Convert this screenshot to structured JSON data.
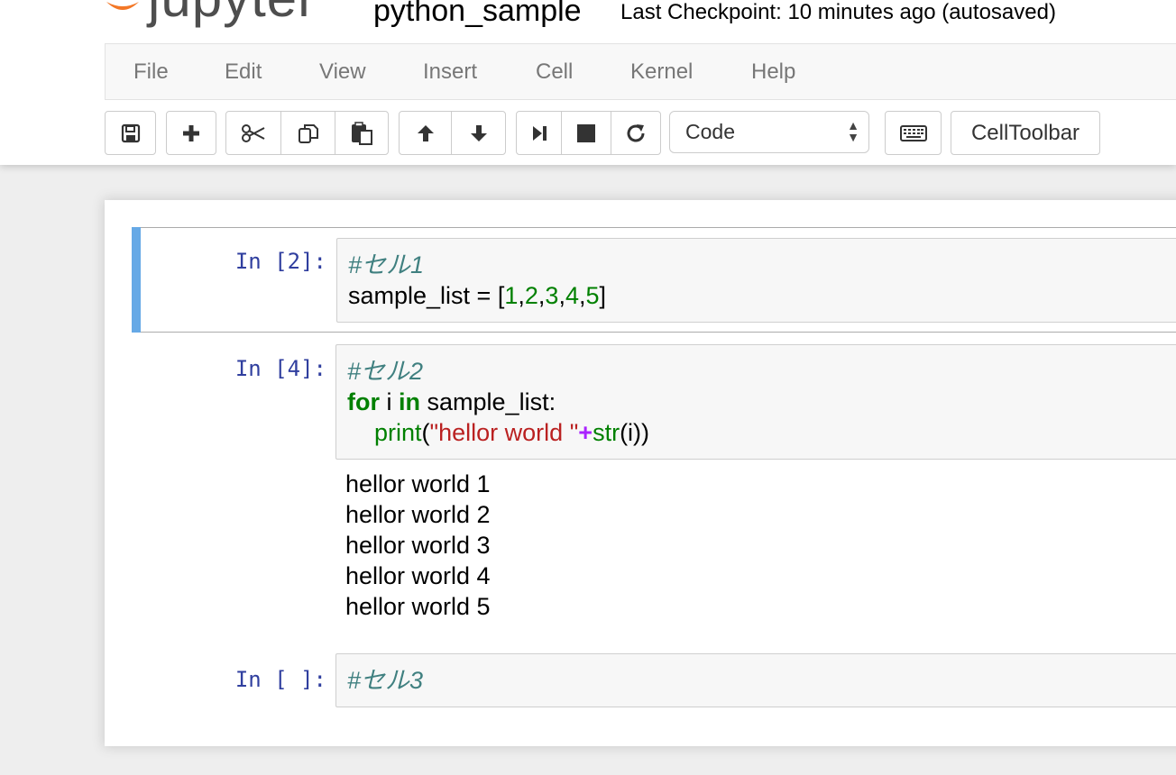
{
  "header": {
    "logo_text": "jupyter",
    "notebook_name": "python_sample",
    "checkpoint": "Last Checkpoint: 10 minutes ago (autosaved)"
  },
  "menubar": {
    "items": [
      {
        "label": "File"
      },
      {
        "label": "Edit"
      },
      {
        "label": "View"
      },
      {
        "label": "Insert"
      },
      {
        "label": "Cell"
      },
      {
        "label": "Kernel"
      },
      {
        "label": "Help"
      }
    ]
  },
  "toolbar": {
    "cell_type": "Code",
    "celltoolbar_label": "CellToolbar",
    "icons": [
      "save-icon",
      "plus-icon",
      "scissors-icon",
      "copy-icon",
      "paste-icon",
      "arrow-up-icon",
      "arrow-down-icon",
      "run-next-icon",
      "stop-icon",
      "restart-icon",
      "keyboard-icon"
    ]
  },
  "cells": [
    {
      "prompt": "In [2]:",
      "selected": true,
      "lines": [
        [
          {
            "t": "#セル1",
            "c": "cm-comment"
          }
        ],
        [
          {
            "t": "sample_list = [",
            "c": ""
          },
          {
            "t": "1",
            "c": "cm-number"
          },
          {
            "t": ",",
            "c": ""
          },
          {
            "t": "2",
            "c": "cm-number"
          },
          {
            "t": ",",
            "c": ""
          },
          {
            "t": "3",
            "c": "cm-number"
          },
          {
            "t": ",",
            "c": ""
          },
          {
            "t": "4",
            "c": "cm-number"
          },
          {
            "t": ",",
            "c": ""
          },
          {
            "t": "5",
            "c": "cm-number"
          },
          {
            "t": "]",
            "c": ""
          }
        ]
      ],
      "outputs": []
    },
    {
      "prompt": "In [4]:",
      "selected": false,
      "lines": [
        [
          {
            "t": "#セル2",
            "c": "cm-comment"
          }
        ],
        [
          {
            "t": "for",
            "c": "cm-keyword"
          },
          {
            "t": " i ",
            "c": ""
          },
          {
            "t": "in",
            "c": "cm-keyword"
          },
          {
            "t": " sample_list:",
            "c": ""
          }
        ],
        [
          {
            "t": "    ",
            "c": ""
          },
          {
            "t": "print",
            "c": "cm-builtin"
          },
          {
            "t": "(",
            "c": ""
          },
          {
            "t": "\"hellor world \"",
            "c": "cm-string"
          },
          {
            "t": "+",
            "c": "cm-op"
          },
          {
            "t": "str",
            "c": "cm-builtin"
          },
          {
            "t": "(i))",
            "c": ""
          }
        ]
      ],
      "outputs": [
        "hellor world 1",
        "hellor world 2",
        "hellor world 3",
        "hellor world 4",
        "hellor world 5"
      ]
    },
    {
      "prompt": "In [ ]:",
      "selected": false,
      "lines": [
        [
          {
            "t": "#セル3",
            "c": "cm-comment"
          }
        ]
      ],
      "outputs": []
    }
  ],
  "colors": {
    "prompt": "#303f9f",
    "selection_bar": "#66a9e6",
    "comment": "#408080",
    "keyword": "#008000",
    "string": "#ba2121",
    "operator": "#aa22ff"
  }
}
